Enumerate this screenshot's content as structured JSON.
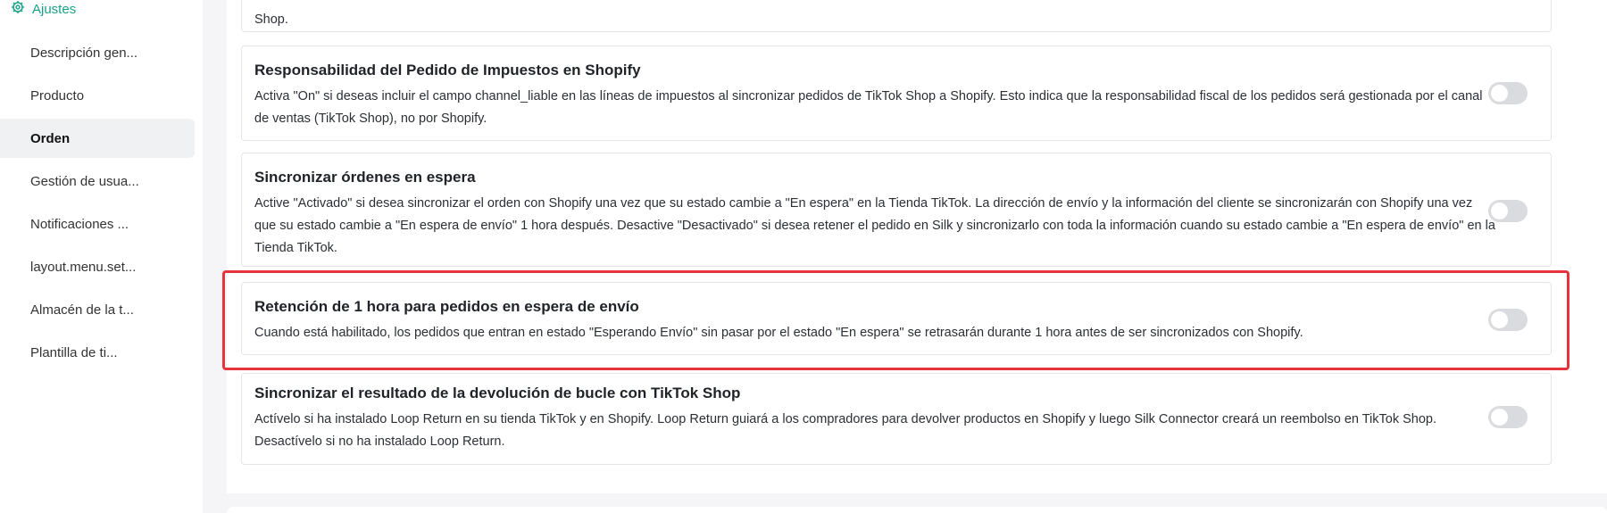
{
  "sidebar": {
    "header": "Ajustes",
    "items": [
      {
        "label": "Descripción gen..."
      },
      {
        "label": "Producto"
      },
      {
        "label": "Orden"
      },
      {
        "label": "Gestión de usua..."
      },
      {
        "label": "Notificaciones ..."
      },
      {
        "label": "layout.menu.set..."
      },
      {
        "label": "Almacén de la t..."
      },
      {
        "label": "Plantilla de ti..."
      }
    ],
    "active_item": "Orden"
  },
  "settings": {
    "top_fragment": "Shop.",
    "cards": [
      {
        "title": "Responsabilidad del Pedido de Impuestos en Shopify",
        "desc": "Activa \"On\" si deseas incluir el campo channel_liable en las líneas de impuestos al sincronizar pedidos de TikTok Shop a Shopify. Esto indica que la responsabilidad fiscal de los pedidos será gestionada por el canal de ventas (TikTok Shop), no por Shopify.",
        "enabled": false
      },
      {
        "title": "Sincronizar órdenes en espera",
        "desc": "Active \"Activado\" si desea sincronizar el orden con Shopify una vez que su estado cambie a \"En espera\" en la Tienda TikTok. La dirección de envío y la información del cliente se sincronizarán con Shopify una vez que su estado cambie a \"En espera de envío\" 1 hora después. Desactive \"Desactivado\" si desea retener el pedido en Silk y sincronizarlo con toda la información cuando su estado cambie a \"En espera de envío\" en la Tienda TikTok.",
        "enabled": false
      },
      {
        "title": "Retención de 1 hora para pedidos en espera de envío",
        "desc": "Cuando está habilitado, los pedidos que entran en estado \"Esperando Envío\" sin pasar por el estado \"En espera\" se retrasarán durante 1 hora antes de ser sincronizados con Shopify.",
        "enabled": false
      },
      {
        "title": "Sincronizar el resultado de la devolución de bucle con TikTok Shop",
        "desc": "Actívelo si ha instalado Loop Return en su tienda TikTok y en Shopify. Loop Return guiará a los compradores para devolver productos en Shopify y luego Silk Connector creará un reembolso en TikTok Shop. Desactívelo si no ha instalado Loop Return.",
        "enabled": false
      }
    ]
  },
  "colors": {
    "accent": "#1aa18a",
    "highlight": "#e5343b",
    "toggle_off": "#d9dbde"
  }
}
